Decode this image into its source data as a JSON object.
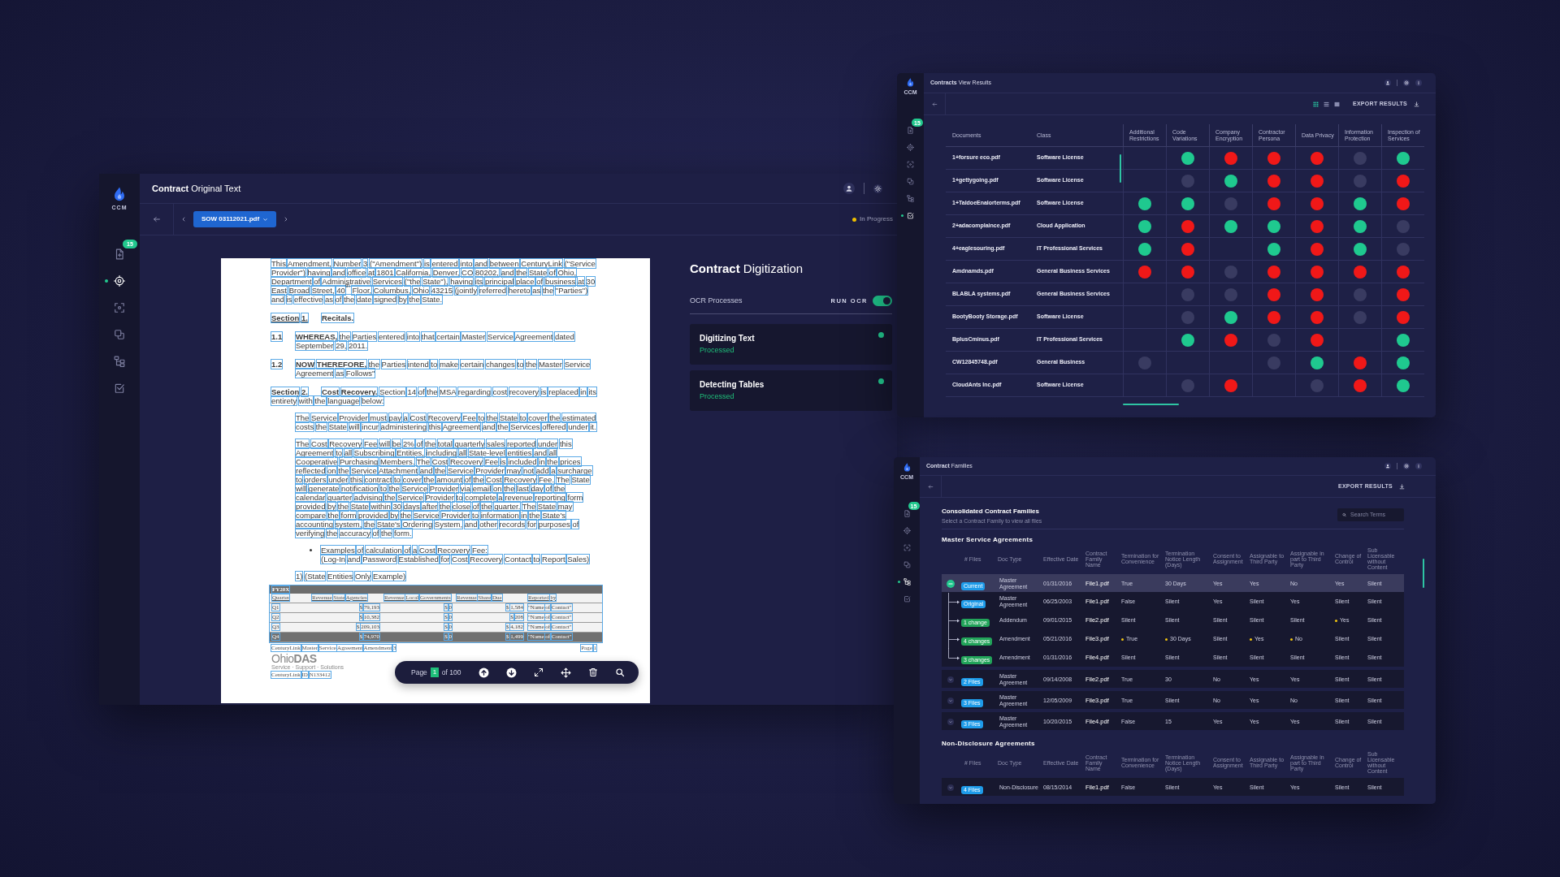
{
  "original_text_window": {
    "logo": "CCM",
    "nav": {
      "badge": "15",
      "items": [
        {
          "selected": false
        },
        {
          "selected": true
        },
        {
          "selected": false
        },
        {
          "selected": false
        },
        {
          "selected": false
        },
        {
          "selected": false
        }
      ]
    },
    "title": "**Contract** Original Text",
    "file_button": "SOW 03112021.pdf",
    "status": "In Progress",
    "document": {
      "blocks": [
        {
          "kind": "paragraph",
          "text": "This Amendment, Number 3 (\"Amendment\") is entered into and between CenturyLink (\"Service Provider\") having and office at 1801 California, Denver, CO 80202, and the State of Ohio, Department of Administrative Services (\"the State\"), having its principal place of business at 30 East Broad Street, 40$^{th}$ Floor, Columbus, Ohio 43215 (jointly referred hereto as the \"Parties\") and is effective as of the date signed by the State."
        },
        {
          "kind": "section",
          "number": "Section 1.",
          "title": "Recitals."
        },
        {
          "kind": "clause",
          "number": "1.1",
          "text": "**WHEREAS,** the Parties entered into that certain Master Service Agreement dated September 29, 2011."
        },
        {
          "kind": "clause",
          "number": "1.2",
          "text": "**NOW THEREFORE,** the Parties intend to make certain changes to the Master Service Agreement as Follows\""
        },
        {
          "kind": "section",
          "number": "Section 2.",
          "title": "Cost Recovery.",
          "text": "Section 14 of the MSA regarding cost recovery is replaced in its entirety with the language below:"
        },
        {
          "kind": "indented",
          "text": "The Service Provider must pay a Cost Recovery Fee to the State to cover the estimated costs the State will incur administering this Agreement and the Services offered under it."
        },
        {
          "kind": "indented",
          "text": "The Cost Recovery Fee will be 2% of the total quarterly sales reported under this Agreement to all Subscribing Entities, including all State-level entities and all Cooperative Purchasing Members. The Cost Recovery Fee is included in the prices reflected on the Service Attachment and the Service Provider may not add a surcharge to orders under this contract to cover the amount of the Cost Recovery Fee. The State will generate notification to the Service Provider via email on the last day of the calendar quarter advising the Service Provider to complete a revenue reporting form provided by the State within 30 days after the close of the quarter. The State may compare the form provided by the Service Provider to information in the State's accounting system, the State's Ordering System, and other records for purposes of verifying the accuracy of the form."
        },
        {
          "kind": "bullet",
          "lines": [
            "Examples of calculation of a Cost Recovery Fee:",
            "(Log-In and Password Established for Cost Recovery Contact to Report Sales)"
          ]
        },
        {
          "kind": "indented",
          "text": "1) (State Entities Only Example)"
        },
        {
          "kind": "table",
          "caption": "FY20X",
          "columns": [
            "Quarter",
            "Revenue State Agencies",
            "Revenue Local Governments",
            "Revenue Share Due",
            "Reported by"
          ],
          "rows": [
            {
              "cells": [
                "Q1",
                "$ 79,193",
                "$ 0",
                "$ 1,584",
                "\"Name of Contact\""
              ],
              "shaded": false
            },
            {
              "cells": [
                "Q2",
                "$ 10,382",
                "$ 0",
                "$ 208",
                "\"Name of Contact\""
              ],
              "shaded": false
            },
            {
              "cells": [
                "Q3",
                "$ 209,103",
                "$ 0",
                "$ 4,182",
                "\"Name of Contact\""
              ],
              "shaded": false
            },
            {
              "cells": [
                "Q4",
                "$ 74,970",
                "$ 0",
                "$ 1,499",
                "\"Name of Contact\""
              ],
              "shaded": true
            }
          ]
        },
        {
          "kind": "footer",
          "left": "CenturyLink Master Service Agreement Amendment 3",
          "right": "Page 1"
        },
        {
          "kind": "logo",
          "text": "Ohio**DAS**",
          "tagline": "Service · Support · Solutions"
        },
        {
          "kind": "note",
          "text": "CenturyLink ID N133412"
        }
      ]
    },
    "pager": {
      "label": "Page",
      "page": "1",
      "total": "of 100"
    },
    "digitization": {
      "title": "**Contract** Digitization",
      "section": "OCR Processes",
      "toggle": {
        "label": "RUN OCR",
        "on": true
      },
      "processes": [
        {
          "name": "Digitizing Text",
          "status": "Processed"
        },
        {
          "name": "Detecting Tables",
          "status": "Processed"
        }
      ]
    }
  },
  "results_window": {
    "logo": "CCM",
    "nav": {
      "badge": "15",
      "items": [
        {
          "selected": false
        },
        {
          "selected": false
        },
        {
          "selected": false
        },
        {
          "selected": false
        },
        {
          "selected": false
        },
        {
          "selected": true
        }
      ]
    },
    "title": "**Contracts** View Results",
    "views": [
      {
        "selected": true
      },
      {
        "selected": false
      },
      {
        "selected": false
      }
    ],
    "export": "EXPORT RESULTS",
    "table": {
      "columns": [
        "Documents",
        "Class",
        "Additional Restrictions",
        "Code Variations",
        "Company Encryption",
        "Contractor Persona",
        "Data Privacy",
        "Information Protection",
        "Inspection of Services"
      ],
      "rows": [
        {
          "document": "1+forsure eco.pdf",
          "class": "Software License",
          "flags": [
            {
              "kind": "empty"
            },
            {
              "kind": "dot",
              "color": "#1fc98f"
            },
            {
              "kind": "dot",
              "color": "#f01818"
            },
            {
              "kind": "dot",
              "color": "#f01818"
            },
            {
              "kind": "dot",
              "color": "#f01818"
            },
            {
              "kind": "dot",
              "color": "#393b61"
            },
            {
              "kind": "dot",
              "color": "#1fc98f"
            }
          ]
        },
        {
          "document": "1+gettygoing.pdf",
          "class": "Software License",
          "flags": [
            {
              "kind": "empty"
            },
            {
              "kind": "dot",
              "color": "#393b61"
            },
            {
              "kind": "dot",
              "color": "#1fc98f"
            },
            {
              "kind": "dot",
              "color": "#f01818"
            },
            {
              "kind": "dot",
              "color": "#f01818"
            },
            {
              "kind": "dot",
              "color": "#393b61"
            },
            {
              "kind": "dot",
              "color": "#f01818"
            }
          ]
        },
        {
          "document": "1+TaldoeEnalorterms.pdf",
          "class": "Software License",
          "flags": [
            {
              "kind": "dot",
              "color": "#1fc98f"
            },
            {
              "kind": "dot",
              "color": "#1fc98f"
            },
            {
              "kind": "dot",
              "color": "#393b61"
            },
            {
              "kind": "dot",
              "color": "#f01818"
            },
            {
              "kind": "dot",
              "color": "#f01818"
            },
            {
              "kind": "dot",
              "color": "#1fc98f"
            },
            {
              "kind": "dot",
              "color": "#f01818"
            }
          ]
        },
        {
          "document": "2+adacomplaince.pdf",
          "class": "Cloud Application",
          "flags": [
            {
              "kind": "dot",
              "color": "#1fc98f"
            },
            {
              "kind": "dot",
              "color": "#f01818"
            },
            {
              "kind": "dot",
              "color": "#1fc98f"
            },
            {
              "kind": "dot",
              "color": "#1fc98f"
            },
            {
              "kind": "dot",
              "color": "#f01818"
            },
            {
              "kind": "dot",
              "color": "#1fc98f"
            },
            {
              "kind": "dot",
              "color": "#393b61"
            }
          ]
        },
        {
          "document": "4+eaglesouring.pdf",
          "class": "IT Professional Services",
          "flags": [
            {
              "kind": "dot",
              "color": "#1fc98f"
            },
            {
              "kind": "dot",
              "color": "#f01818"
            },
            {
              "kind": "empty"
            },
            {
              "kind": "dot",
              "color": "#1fc98f"
            },
            {
              "kind": "dot",
              "color": "#f01818"
            },
            {
              "kind": "dot",
              "color": "#1fc98f"
            },
            {
              "kind": "dot",
              "color": "#393b61"
            }
          ]
        },
        {
          "document": "Amdnamds.pdf",
          "class": "General Business Services",
          "flags": [
            {
              "kind": "dot",
              "color": "#f01818"
            },
            {
              "kind": "dot",
              "color": "#f01818"
            },
            {
              "kind": "dot",
              "color": "#393b61"
            },
            {
              "kind": "dot",
              "color": "#f01818"
            },
            {
              "kind": "dot",
              "color": "#f01818"
            },
            {
              "kind": "dot",
              "color": "#f01818"
            },
            {
              "kind": "dot",
              "color": "#f01818"
            }
          ]
        },
        {
          "document": "BLABLA systems.pdf",
          "class": "General Business Services",
          "flags": [
            {
              "kind": "empty"
            },
            {
              "kind": "dot",
              "color": "#393b61"
            },
            {
              "kind": "dot",
              "color": "#393b61"
            },
            {
              "kind": "dot",
              "color": "#f01818"
            },
            {
              "kind": "dot",
              "color": "#f01818"
            },
            {
              "kind": "dot",
              "color": "#393b61"
            },
            {
              "kind": "dot",
              "color": "#f01818"
            }
          ]
        },
        {
          "document": "BootyBooty Storage.pdf",
          "class": "Software License",
          "flags": [
            {
              "kind": "empty"
            },
            {
              "kind": "dot",
              "color": "#393b61"
            },
            {
              "kind": "dot",
              "color": "#1fc98f"
            },
            {
              "kind": "dot",
              "color": "#f01818"
            },
            {
              "kind": "dot",
              "color": "#f01818"
            },
            {
              "kind": "dot",
              "color": "#393b61"
            },
            {
              "kind": "dot",
              "color": "#f01818"
            }
          ]
        },
        {
          "document": "BplusCminus.pdf",
          "class": "IT Professional Services",
          "flags": [
            {
              "kind": "empty"
            },
            {
              "kind": "dot",
              "color": "#1fc98f"
            },
            {
              "kind": "dot",
              "color": "#f01818"
            },
            {
              "kind": "dot",
              "color": "#393b61"
            },
            {
              "kind": "dot",
              "color": "#f01818"
            },
            {
              "kind": "empty"
            },
            {
              "kind": "dot",
              "color": "#1fc98f"
            }
          ]
        },
        {
          "document": "CW12845748.pdf",
          "class": "General Business",
          "flags": [
            {
              "kind": "dot",
              "color": "#393b61"
            },
            {
              "kind": "empty"
            },
            {
              "kind": "empty"
            },
            {
              "kind": "dot",
              "color": "#393b61"
            },
            {
              "kind": "dot",
              "color": "#1fc98f"
            },
            {
              "kind": "dot",
              "color": "#f01818"
            },
            {
              "kind": "dot",
              "color": "#1fc98f"
            }
          ]
        },
        {
          "document": "CloudAnts Inc.pdf",
          "class": "Software License",
          "flags": [
            {
              "kind": "empty"
            },
            {
              "kind": "dot",
              "color": "#393b61"
            },
            {
              "kind": "dot",
              "color": "#f01818"
            },
            {
              "kind": "empty"
            },
            {
              "kind": "dot",
              "color": "#393b61"
            },
            {
              "kind": "dot",
              "color": "#f01818"
            },
            {
              "kind": "dot",
              "color": "#1fc98f"
            }
          ]
        }
      ]
    }
  },
  "families_window": {
    "logo": "CCM",
    "nav": {
      "badge": "15",
      "items": [
        {
          "selected": false
        },
        {
          "selected": false
        },
        {
          "selected": false
        },
        {
          "selected": false
        },
        {
          "selected": true
        },
        {
          "selected": false
        }
      ]
    },
    "title": "**Contract** Families",
    "export": "EXPORT RESULTS",
    "heading": "Consolidated Contract Families",
    "subheading": "Select a Contract Family to view all files",
    "search": {
      "placeholder": "Search Terms"
    },
    "sections": [
      {
        "title": "Master Service Agreements",
        "columns": [
          "# Files",
          "Doc Type",
          "Effective Date",
          "Contract Family Name",
          "Termination for Convenience",
          "Termination Notice Length (Days)",
          "Consent to Assignment",
          "Assignable to Third Party",
          "Assignable in part to Third Party",
          "Change of Control",
          "Sub Licensable without Content"
        ],
        "families": [
          {
            "selected": true,
            "expanded": true,
            "badge": {
              "text": "Current",
              "color": "#1e9be9"
            },
            "doc_type": "Master Agreement",
            "date": "01/31/2016",
            "family": "File1.pdf",
            "terms": [
              {
                "text": "True",
                "changed": false
              },
              {
                "text": "30 Days",
                "changed": false
              },
              {
                "text": "Yes",
                "changed": false
              },
              {
                "text": "Yes",
                "changed": false
              },
              {
                "text": "No",
                "changed": false
              },
              {
                "text": "Yes",
                "changed": false
              },
              {
                "text": "Silent",
                "changed": false
              }
            ],
            "children": [
              {
                "badge": {
                  "text": "Original",
                  "color": "#1e9be9"
                },
                "doc_type": "Master Agreement",
                "date": "06/25/2003",
                "family": "File1.pdf",
                "terms": [
                  {
                    "text": "False",
                    "changed": false
                  },
                  {
                    "text": "Silent",
                    "changed": false
                  },
                  {
                    "text": "Yes",
                    "changed": false
                  },
                  {
                    "text": "Silent",
                    "changed": false
                  },
                  {
                    "text": "Yes",
                    "changed": false
                  },
                  {
                    "text": "Silent",
                    "changed": false
                  },
                  {
                    "text": "Silent",
                    "changed": false
                  }
                ]
              },
              {
                "badge": {
                  "text": "1 change",
                  "color": "#22a45a"
                },
                "doc_type": "Addendum",
                "date": "09/01/2015",
                "family": "File2.pdf",
                "terms": [
                  {
                    "text": "Silent",
                    "changed": false
                  },
                  {
                    "text": "Silent",
                    "changed": false
                  },
                  {
                    "text": "Silent",
                    "changed": false
                  },
                  {
                    "text": "Silent",
                    "changed": false
                  },
                  {
                    "text": "Silent",
                    "changed": false
                  },
                  {
                    "text": "Yes",
                    "changed": true
                  },
                  {
                    "text": "Silent",
                    "changed": false
                  }
                ]
              },
              {
                "badge": {
                  "text": "4 changes",
                  "color": "#22a45a"
                },
                "doc_type": "Amendment",
                "date": "05/21/2016",
                "family": "File3.pdf",
                "terms": [
                  {
                    "text": "True",
                    "changed": true
                  },
                  {
                    "text": "30 Days",
                    "changed": true
                  },
                  {
                    "text": "Silent",
                    "changed": false
                  },
                  {
                    "text": "Yes",
                    "changed": true
                  },
                  {
                    "text": "No",
                    "changed": true
                  },
                  {
                    "text": "Silent",
                    "changed": false
                  },
                  {
                    "text": "Silent",
                    "changed": false
                  }
                ]
              },
              {
                "badge": {
                  "text": "3 changes",
                  "color": "#22a45a"
                },
                "doc_type": "Amendment",
                "date": "01/31/2016",
                "family": "File4.pdf",
                "terms": [
                  {
                    "text": "Silent",
                    "changed": false
                  },
                  {
                    "text": "Silent",
                    "changed": false
                  },
                  {
                    "text": "Silent",
                    "changed": false
                  },
                  {
                    "text": "Silent",
                    "changed": false
                  },
                  {
                    "text": "Silent",
                    "changed": false
                  },
                  {
                    "text": "Silent",
                    "changed": false
                  },
                  {
                    "text": "Silent",
                    "changed": false
                  }
                ]
              }
            ]
          },
          {
            "selected": false,
            "expanded": false,
            "badge": {
              "text": "2 Files",
              "color": "#1e9be9"
            },
            "doc_type": "Master Agreement",
            "date": "09/14/2008",
            "family": "File2.pdf",
            "terms": [
              {
                "text": "True",
                "changed": false
              },
              {
                "text": "30",
                "changed": false
              },
              {
                "text": "No",
                "changed": false
              },
              {
                "text": "Yes",
                "changed": false
              },
              {
                "text": "Yes",
                "changed": false
              },
              {
                "text": "Silent",
                "changed": false
              },
              {
                "text": "Silent",
                "changed": false
              }
            ]
          },
          {
            "selected": false,
            "expanded": false,
            "badge": {
              "text": "3 Files",
              "color": "#1e9be9"
            },
            "doc_type": "Master Agreement",
            "date": "12/05/2009",
            "family": "File3.pdf",
            "terms": [
              {
                "text": "True",
                "changed": false
              },
              {
                "text": "Silent",
                "changed": false
              },
              {
                "text": "No",
                "changed": false
              },
              {
                "text": "Yes",
                "changed": false
              },
              {
                "text": "No",
                "changed": false
              },
              {
                "text": "Silent",
                "changed": false
              },
              {
                "text": "Silent",
                "changed": false
              }
            ]
          },
          {
            "selected": false,
            "expanded": false,
            "badge": {
              "text": "3 Files",
              "color": "#1e9be9"
            },
            "doc_type": "Master Agreement",
            "date": "10/20/2015",
            "family": "File4.pdf",
            "terms": [
              {
                "text": "False",
                "changed": false
              },
              {
                "text": "15",
                "changed": false
              },
              {
                "text": "Yes",
                "changed": false
              },
              {
                "text": "Yes",
                "changed": false
              },
              {
                "text": "Yes",
                "changed": false
              },
              {
                "text": "Silent",
                "changed": false
              },
              {
                "text": "Silent",
                "changed": false
              }
            ]
          }
        ]
      },
      {
        "title": "Non-Disclosure Agreements",
        "columns": [
          "# Files",
          "Doc Type",
          "Effective Date",
          "Contract Family Name",
          "Termination for Convenience",
          "Termination Notice Length (Days)",
          "Consent to Assignment",
          "Assignable to Third Party",
          "Assignable in part to Third Party",
          "Change of Control",
          "Sub Licensable without Content"
        ],
        "families": [
          {
            "selected": false,
            "expanded": false,
            "badge": {
              "text": "4 Files",
              "color": "#1e9be9"
            },
            "doc_type": "Non-Disclosure",
            "date": "08/15/2014",
            "family": "File1.pdf",
            "terms": [
              {
                "text": "False",
                "changed": false
              },
              {
                "text": "Silent",
                "changed": false
              },
              {
                "text": "Yes",
                "changed": false
              },
              {
                "text": "Silent",
                "changed": false
              },
              {
                "text": "Yes",
                "changed": false
              },
              {
                "text": "Silent",
                "changed": false
              },
              {
                "text": "Silent",
                "changed": false
              }
            ]
          }
        ]
      }
    ]
  }
}
